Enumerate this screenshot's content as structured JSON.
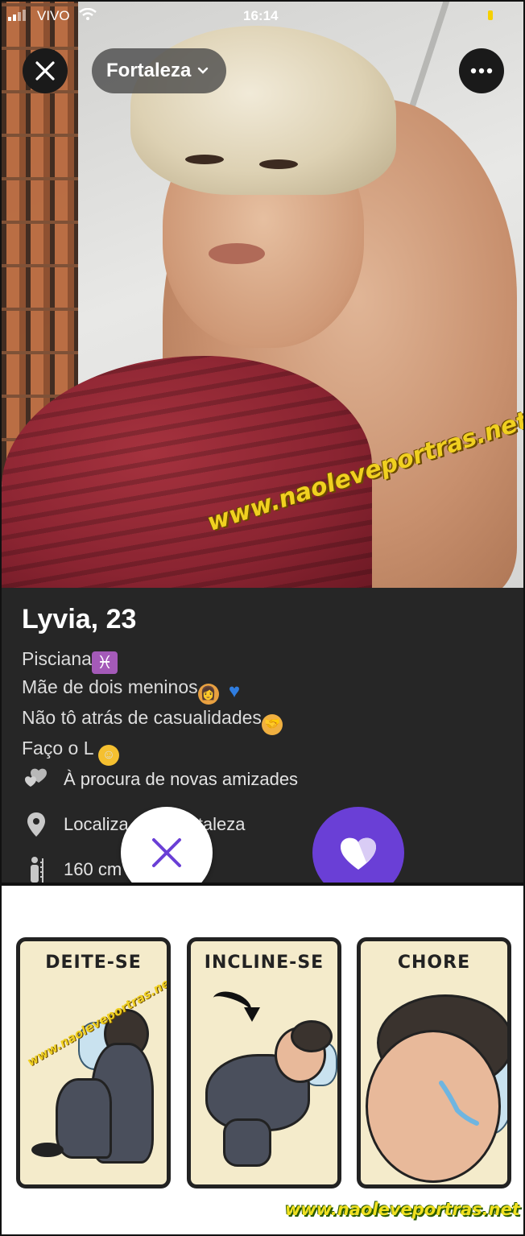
{
  "status_bar": {
    "carrier": "VIVO",
    "time": "16:14"
  },
  "header": {
    "location": "Fortaleza",
    "icons": [
      "close-icon",
      "chevron-down-icon",
      "more-icon"
    ]
  },
  "profile": {
    "name": "Lyvia, 23",
    "bio_lines": [
      "Pisciana",
      "Mãe de dois meninos",
      "Não tô atrás de casualidades",
      "Faço o L"
    ],
    "looking_for": "À procura de novas amizades",
    "location_partial_left": "Localiza",
    "location_partial_right": "taleza",
    "height": "160 cm"
  },
  "actions": {
    "icons": [
      "dislike-icon",
      "like-heart-icon"
    ],
    "accent_color": "#6a3fd6"
  },
  "watermarks": {
    "photo": "www.naoleveportras.net",
    "comic": "www.naoleveportras.net",
    "bottom": "www.naoleveportras.net"
  },
  "comic": {
    "panels": [
      {
        "title": "DEITE-SE"
      },
      {
        "title": "INCLINE-SE"
      },
      {
        "title": "CHORE"
      }
    ]
  }
}
